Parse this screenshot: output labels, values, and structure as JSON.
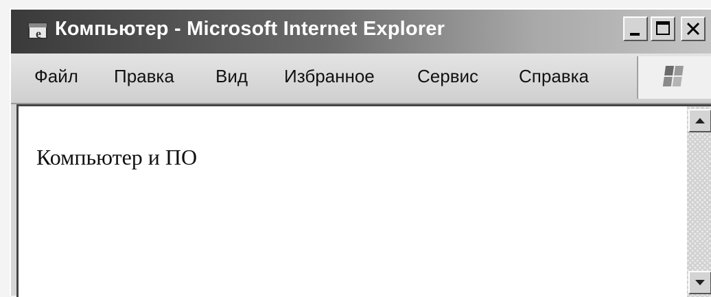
{
  "window": {
    "title": "Компьютер - Microsoft Internet Explorer",
    "controls": [
      "minimize",
      "maximize",
      "close"
    ]
  },
  "menu": {
    "items": [
      "Файл",
      "Правка",
      "Вид",
      "Избранное",
      "Сервис",
      "Справка"
    ]
  },
  "page": {
    "text": "Компьютер и ПО"
  },
  "icons": {
    "app": "internet-explorer-icon",
    "brand": "windows-logo-icon",
    "scroll_up": "scroll-up-arrow-icon",
    "scroll_down": "scroll-down-arrow-icon"
  }
}
